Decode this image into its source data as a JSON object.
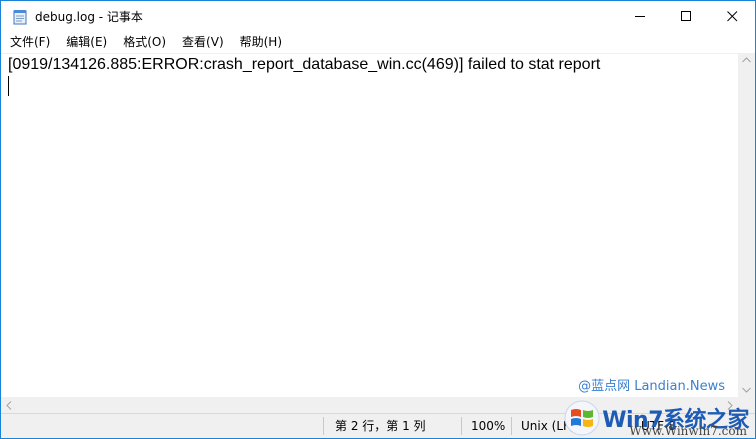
{
  "window": {
    "title": "debug.log - 记事本"
  },
  "menu": [
    {
      "label": "文件(F)"
    },
    {
      "label": "编辑(E)"
    },
    {
      "label": "格式(O)"
    },
    {
      "label": "查看(V)"
    },
    {
      "label": "帮助(H)"
    }
  ],
  "editor": {
    "line1": "[0919/134126.885:ERROR:crash_report_database_win.cc(469)] failed to stat report"
  },
  "status": {
    "position": "第 2 行，第 1 列",
    "zoom": "100%",
    "line_ending": "Unix (LF)",
    "encoding": "UTF-8"
  },
  "watermark": {
    "site": "@蓝点网 Landian.News",
    "logo_text": "Win7系统之家",
    "logo_url": "Www.Winwin7.com"
  },
  "colors": {
    "window_border": "#1883d7",
    "status_bg": "#f0f0f0"
  },
  "icons": {
    "app": "notepad-icon",
    "minimize": "minimize-icon",
    "maximize": "maximize-icon",
    "close": "close-icon"
  }
}
